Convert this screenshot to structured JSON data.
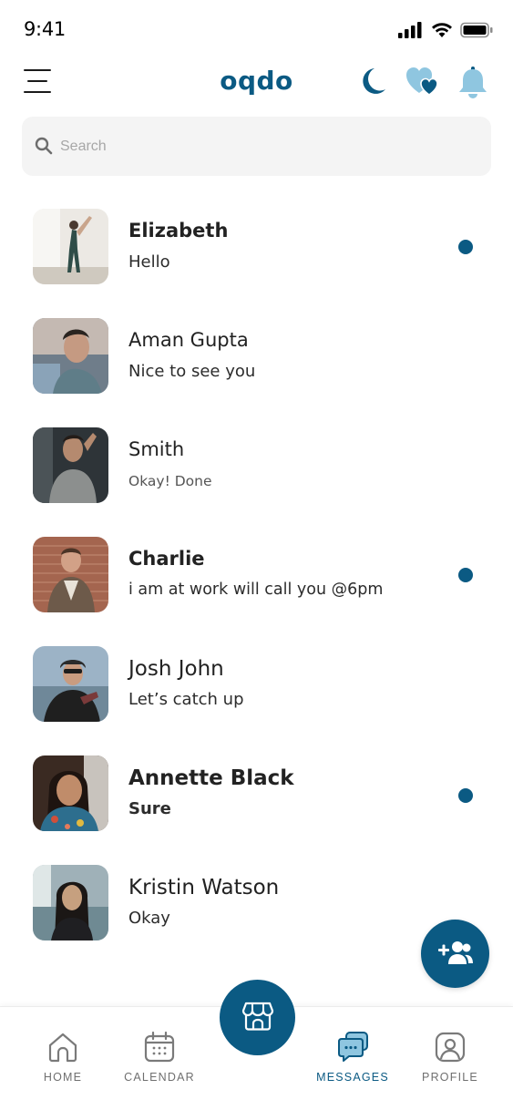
{
  "status_bar": {
    "time": "9:41"
  },
  "header": {
    "logo": "oqdo",
    "icons": [
      "moon-icon",
      "hearts-icon",
      "bell-icon"
    ]
  },
  "search": {
    "placeholder": "Search",
    "value": ""
  },
  "chats": [
    {
      "name": "Elizabeth",
      "preview": "Hello",
      "unread": true
    },
    {
      "name": "Aman Gupta",
      "preview": "Nice to see you",
      "unread": false
    },
    {
      "name": "Smith",
      "preview": "Okay! Done",
      "unread": false
    },
    {
      "name": "Charlie",
      "preview": "i am at work will call you @6pm",
      "unread": true
    },
    {
      "name": "Josh John",
      "preview": "Let’s catch up",
      "unread": false
    },
    {
      "name": "Annette Black",
      "preview": "Sure",
      "unread": true
    },
    {
      "name": "Kristin Watson",
      "preview": "Okay",
      "unread": false
    }
  ],
  "fab": {
    "icon": "add-group-icon"
  },
  "bottom_nav": {
    "items": [
      {
        "label": "HOME",
        "icon": "home-icon",
        "active": false
      },
      {
        "label": "CALENDAR",
        "icon": "calendar-icon",
        "active": false
      },
      {
        "label": "MESSAGES",
        "icon": "messages-icon",
        "active": true
      },
      {
        "label": "PROFILE",
        "icon": "profile-icon",
        "active": false
      }
    ],
    "center_icon": "store-icon"
  },
  "colors": {
    "accent": "#0b5a83",
    "accent_light": "#2e7da6",
    "unread_dot": "#0b5a83",
    "search_bg": "#f4f4f4"
  }
}
